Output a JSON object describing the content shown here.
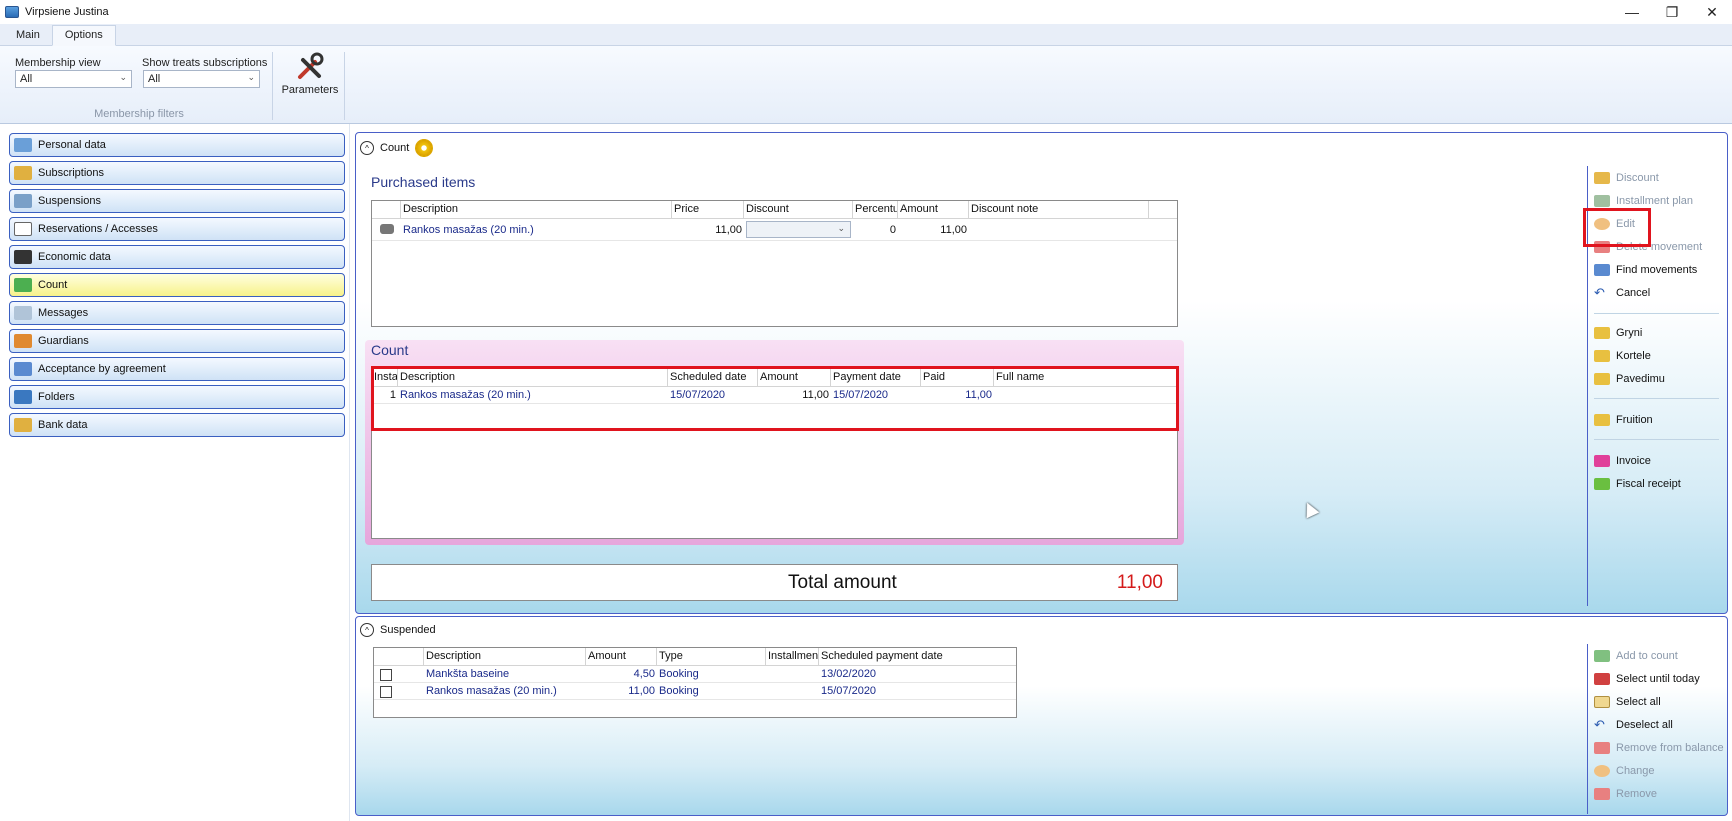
{
  "window": {
    "title": "Virpsiene Justina"
  },
  "tabs": [
    {
      "label": "Main"
    },
    {
      "label": "Options"
    }
  ],
  "ribbon": {
    "membership_view": {
      "label": "Membership view",
      "value": "All"
    },
    "show_treats": {
      "label": "Show treats subscriptions",
      "value": "All"
    },
    "group_label": "Membership filters",
    "parameters_label": "Parameters"
  },
  "nav": [
    {
      "label": "Personal data",
      "icon": "id-card-icon"
    },
    {
      "label": "Subscriptions",
      "icon": "card-icon"
    },
    {
      "label": "Suspensions",
      "icon": "suspension-icon"
    },
    {
      "label": "Reservations / Accesses",
      "icon": "checklist-icon"
    },
    {
      "label": "Economic data",
      "icon": "wallet-icon"
    },
    {
      "label": "Count",
      "icon": "money-icon"
    },
    {
      "label": "Messages",
      "icon": "message-icon"
    },
    {
      "label": "Guardians",
      "icon": "guardians-icon"
    },
    {
      "label": "Acceptance by agreement",
      "icon": "agreement-icon"
    },
    {
      "label": "Folders",
      "icon": "folders-icon"
    },
    {
      "label": "Bank data",
      "icon": "bank-icon"
    }
  ],
  "count_panel": {
    "title": "Count",
    "purchased_title": "Purchased items",
    "purchased_headers": [
      "Description",
      "Price",
      "Discount",
      "Percentu",
      "Amount",
      "Discount note"
    ],
    "purchased_rows": [
      {
        "description": "Rankos masažas (20 min.)",
        "price": "11,00",
        "discount": "",
        "percent": "0",
        "amount": "11,00",
        "note": ""
      }
    ],
    "count_title": "Count",
    "count_headers": [
      "Insta",
      "Description",
      "Scheduled date",
      "Amount",
      "Payment date",
      "Paid",
      "Full name"
    ],
    "count_rows": [
      {
        "inst": "1",
        "description": "Rankos masažas (20 min.)",
        "scheduled": "15/07/2020",
        "amount": "11,00",
        "payment": "15/07/2020",
        "paid": "11,00",
        "fullname": ""
      }
    ],
    "total_label": "Total amount",
    "total_value": "11,00",
    "actions": [
      {
        "label": "Discount",
        "disabled": true
      },
      {
        "label": "Installment plan",
        "disabled": true
      },
      {
        "label": "Edit",
        "disabled": true
      },
      {
        "label": "Delete movement",
        "disabled": true
      },
      {
        "label": "Find movements",
        "disabled": false
      },
      {
        "label": "Cancel",
        "disabled": false
      },
      {
        "label": "Gryni",
        "disabled": false
      },
      {
        "label": "Kortele",
        "disabled": false
      },
      {
        "label": "Pavedimu",
        "disabled": false
      },
      {
        "label": "Fruition",
        "disabled": false
      },
      {
        "label": "Invoice",
        "disabled": false
      },
      {
        "label": "Fiscal receipt",
        "disabled": false
      }
    ]
  },
  "suspended_panel": {
    "title": "Suspended",
    "headers": [
      "",
      "Description",
      "Amount",
      "Type",
      "Installmen",
      "Scheduled payment date"
    ],
    "rows": [
      {
        "description": "Mankšta baseine",
        "amount": "4,50",
        "type": "Booking",
        "inst": "",
        "date": "13/02/2020"
      },
      {
        "description": "Rankos masažas (20 min.)",
        "amount": "11,00",
        "type": "Booking",
        "inst": "",
        "date": "15/07/2020"
      }
    ],
    "actions": [
      {
        "label": "Add to count",
        "disabled": true
      },
      {
        "label": "Select until today",
        "disabled": false
      },
      {
        "label": "Select all",
        "disabled": false
      },
      {
        "label": "Deselect all",
        "disabled": false
      },
      {
        "label": "Remove from balance",
        "disabled": true
      },
      {
        "label": "Change",
        "disabled": true
      },
      {
        "label": "Remove",
        "disabled": true
      }
    ]
  },
  "colors": {
    "accent_border": "#4a5fc8",
    "highlight": "#e0141e",
    "total_value": "#d41a1a",
    "link_text": "#1a2a8a"
  }
}
